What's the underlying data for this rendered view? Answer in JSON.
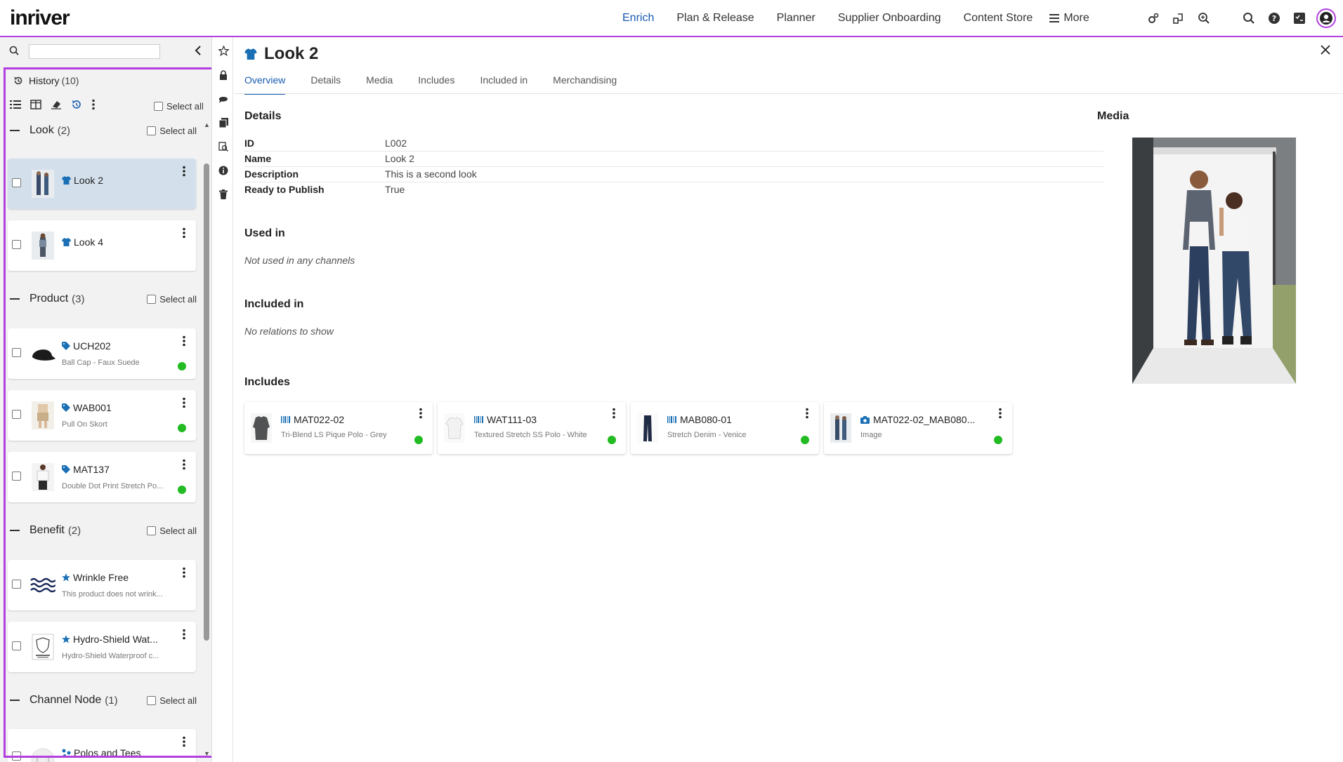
{
  "topbar": {
    "logo": "inriver",
    "nav": [
      "Enrich",
      "Plan & Release",
      "Planner",
      "Supplier Onboarding",
      "Content Store"
    ],
    "active_nav": "Enrich",
    "more_label": "More"
  },
  "left": {
    "history_label": "History",
    "history_count": "(10)",
    "select_all": "Select all",
    "groups": [
      {
        "name": "Look",
        "count": "(2)"
      },
      {
        "name": "Product",
        "count": "(3)"
      },
      {
        "name": "Benefit",
        "count": "(2)"
      },
      {
        "name": "Channel Node",
        "count": "(1)"
      }
    ],
    "cards": [
      {
        "title": "Look 2",
        "sub": ""
      },
      {
        "title": "Look 4",
        "sub": ""
      },
      {
        "title": "UCH202",
        "sub": "Ball Cap - Faux Suede"
      },
      {
        "title": "WAB001",
        "sub": "Pull On Skort"
      },
      {
        "title": "MAT137",
        "sub": "Double Dot Print Stretch Po..."
      },
      {
        "title": "Wrinkle Free",
        "sub": "This product does not wrink..."
      },
      {
        "title": "Hydro-Shield Wat...",
        "sub": "Hydro-Shield Waterproof c..."
      },
      {
        "title": "Polos and Tees",
        "sub": ""
      }
    ]
  },
  "main": {
    "title": "Look 2",
    "tabs": [
      "Overview",
      "Details",
      "Media",
      "Includes",
      "Included in",
      "Merchandising"
    ],
    "details_head": "Details",
    "details": [
      {
        "k": "ID",
        "v": "L002"
      },
      {
        "k": "Name",
        "v": "Look 2"
      },
      {
        "k": "Description",
        "v": "This is a second look"
      },
      {
        "k": "Ready to Publish",
        "v": "True"
      }
    ],
    "used_in_head": "Used in",
    "used_in_text": "Not used in any channels",
    "included_in_head": "Included in",
    "included_in_text": "No relations to show",
    "includes_head": "Includes",
    "includes": [
      {
        "title": "MAT022-02",
        "sub": "Tri-Blend LS Pique Polo - Grey"
      },
      {
        "title": "WAT111-03",
        "sub": "Textured Stretch SS Polo - White"
      },
      {
        "title": "MAB080-01",
        "sub": "Stretch Denim - Venice"
      },
      {
        "title": "MAT022-02_MAB080...",
        "sub": "Image"
      }
    ],
    "media_head": "Media"
  },
  "colors": {
    "accent": "#b23fe0",
    "link": "#1a5cb0",
    "icon_blue": "#1a6fb5",
    "status_green": "#22bb22",
    "selected_card": "#d3e0ec"
  }
}
